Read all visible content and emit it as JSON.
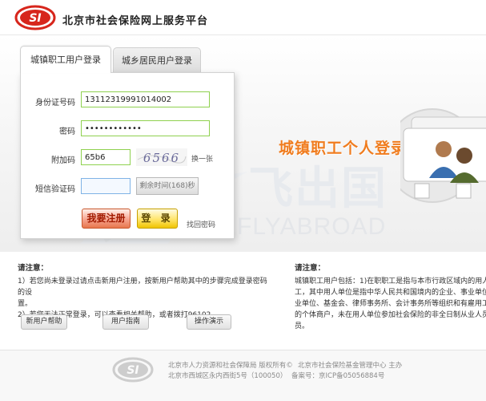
{
  "header": {
    "logo_text": "SI",
    "site_title": "北京市社会保险网上服务平台"
  },
  "tabs": [
    {
      "label": "城镇职工用户登录",
      "active": true
    },
    {
      "label": "城乡居民用户登录",
      "active": false
    }
  ],
  "form": {
    "id_label": "身份证号码",
    "id_value": "13112319991014002",
    "password_label": "密码",
    "password_value": "••••••••••••",
    "captcha_label": "附加码",
    "captcha_value": "65b6",
    "captcha_image_text": "6566",
    "captcha_refresh": "换一张",
    "sms_label": "短信验证码",
    "sms_value": "",
    "sms_button": "剩余时间(168)秒",
    "register_button": "我要注册",
    "login_button": "登 录",
    "forgot_password": "找回密码"
  },
  "banner": {
    "title": "城镇职工个人登录",
    "watermark_cn": "飞出国",
    "watermark_en": "FLYABROAD"
  },
  "notice_left": {
    "title": "请注意：",
    "lines": [
      "1）若您尚未登录过请点击新用户注册，按新用户帮助其中的步骤完成登录密码的设",
      "置。",
      "2）若您无法正常登录，可以查看相关帮助，或者拨打96102。"
    ]
  },
  "notice_right": {
    "title": "请注意：",
    "lines": [
      "城镇职工用户包括：1)在职职工是指与本市行政区域内的用人单位",
      "工，其中用人单位是指中华人民共和国境内的企业、事业单位、社会团",
      "业单位、基金会、律师事务所、会计事务所等组织和有雇用工的个体",
      "的个体商户，未在用人单位参加社会保险的非全日制从业人员以及其他",
      "员。"
    ]
  },
  "help_buttons": [
    {
      "label": "新用户帮助"
    },
    {
      "label": "用户指南"
    },
    {
      "label": "操作演示"
    }
  ],
  "footer": {
    "line1_left": "北京市人力资源和社会保障局 版权所有©",
    "line1_right": "北京市社会保险基金管理中心 主办",
    "line2_left": "北京市西城区永内西街5号（100050）",
    "line2_right": "备案号：京ICP备05056884号"
  },
  "colors": {
    "accent_orange": "#f07c1e",
    "logo_red": "#d7261c",
    "field_green": "#8fd14f"
  }
}
